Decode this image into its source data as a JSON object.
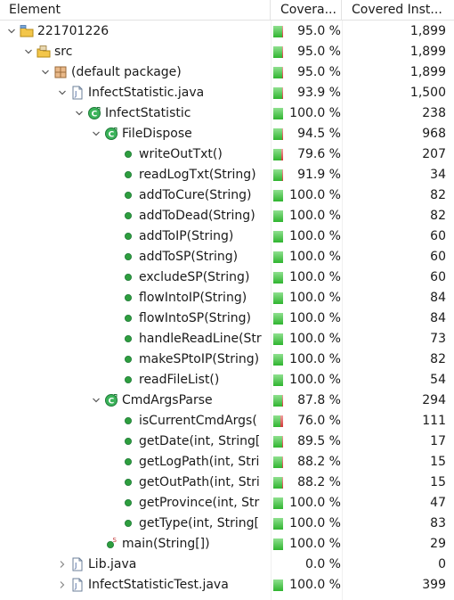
{
  "columns": {
    "element": "Element",
    "coverage": "Covera...",
    "covered": "Covered Inst..."
  },
  "rows": [
    {
      "label": "221701226",
      "coverage": "95.0 %",
      "covered": "1,899",
      "depth": 0,
      "twisty": "down",
      "icon": "project-icon",
      "bar": 95.0
    },
    {
      "label": "src",
      "coverage": "95.0 %",
      "covered": "1,899",
      "depth": 1,
      "twisty": "down",
      "icon": "source-folder-icon",
      "bar": 95.0
    },
    {
      "label": "(default package)",
      "coverage": "95.0 %",
      "covered": "1,899",
      "depth": 2,
      "twisty": "down",
      "icon": "package-icon",
      "bar": 95.0
    },
    {
      "label": "InfectStatistic.java",
      "coverage": "93.9 %",
      "covered": "1,500",
      "depth": 3,
      "twisty": "down",
      "icon": "java-file-icon",
      "bar": 93.9
    },
    {
      "label": "InfectStatistic",
      "coverage": "100.0 %",
      "covered": "238",
      "depth": 4,
      "twisty": "down",
      "icon": "class-icon",
      "bar": 100.0
    },
    {
      "label": "FileDispose",
      "coverage": "94.5 %",
      "covered": "968",
      "depth": 5,
      "twisty": "down",
      "icon": "class-icon",
      "bar": 94.5
    },
    {
      "label": "writeOutTxt()",
      "coverage": "79.6 %",
      "covered": "207",
      "depth": 6,
      "twisty": "",
      "icon": "method-icon",
      "bar": 79.6
    },
    {
      "label": "readLogTxt(String)",
      "coverage": "91.9 %",
      "covered": "34",
      "depth": 6,
      "twisty": "",
      "icon": "method-icon",
      "bar": 91.9
    },
    {
      "label": "addToCure(String)",
      "coverage": "100.0 %",
      "covered": "82",
      "depth": 6,
      "twisty": "",
      "icon": "method-icon",
      "bar": 100.0
    },
    {
      "label": "addToDead(String)",
      "coverage": "100.0 %",
      "covered": "82",
      "depth": 6,
      "twisty": "",
      "icon": "method-icon",
      "bar": 100.0
    },
    {
      "label": "addToIP(String)",
      "coverage": "100.0 %",
      "covered": "60",
      "depth": 6,
      "twisty": "",
      "icon": "method-icon",
      "bar": 100.0
    },
    {
      "label": "addToSP(String)",
      "coverage": "100.0 %",
      "covered": "60",
      "depth": 6,
      "twisty": "",
      "icon": "method-icon",
      "bar": 100.0
    },
    {
      "label": "excludeSP(String)",
      "coverage": "100.0 %",
      "covered": "60",
      "depth": 6,
      "twisty": "",
      "icon": "method-icon",
      "bar": 100.0
    },
    {
      "label": "flowIntoIP(String)",
      "coverage": "100.0 %",
      "covered": "84",
      "depth": 6,
      "twisty": "",
      "icon": "method-icon",
      "bar": 100.0
    },
    {
      "label": "flowIntoSP(String)",
      "coverage": "100.0 %",
      "covered": "84",
      "depth": 6,
      "twisty": "",
      "icon": "method-icon",
      "bar": 100.0
    },
    {
      "label": "handleReadLine(Str",
      "coverage": "100.0 %",
      "covered": "73",
      "depth": 6,
      "twisty": "",
      "icon": "method-icon",
      "bar": 100.0
    },
    {
      "label": "makeSPtoIP(String)",
      "coverage": "100.0 %",
      "covered": "82",
      "depth": 6,
      "twisty": "",
      "icon": "method-icon",
      "bar": 100.0
    },
    {
      "label": "readFileList()",
      "coverage": "100.0 %",
      "covered": "54",
      "depth": 6,
      "twisty": "",
      "icon": "method-icon",
      "bar": 100.0
    },
    {
      "label": "CmdArgsParse",
      "coverage": "87.8 %",
      "covered": "294",
      "depth": 5,
      "twisty": "down",
      "icon": "class-icon",
      "bar": 87.8
    },
    {
      "label": "isCurrentCmdArgs(",
      "coverage": "76.0 %",
      "covered": "111",
      "depth": 6,
      "twisty": "",
      "icon": "method-icon",
      "bar": 76.0
    },
    {
      "label": "getDate(int, String[",
      "coverage": "89.5 %",
      "covered": "17",
      "depth": 6,
      "twisty": "",
      "icon": "method-icon",
      "bar": 89.5
    },
    {
      "label": "getLogPath(int, Stri",
      "coverage": "88.2 %",
      "covered": "15",
      "depth": 6,
      "twisty": "",
      "icon": "method-icon",
      "bar": 88.2
    },
    {
      "label": "getOutPath(int, Stri",
      "coverage": "88.2 %",
      "covered": "15",
      "depth": 6,
      "twisty": "",
      "icon": "method-icon",
      "bar": 88.2
    },
    {
      "label": "getProvince(int, Str",
      "coverage": "100.0 %",
      "covered": "47",
      "depth": 6,
      "twisty": "",
      "icon": "method-icon",
      "bar": 100.0
    },
    {
      "label": "getType(int, String[",
      "coverage": "100.0 %",
      "covered": "83",
      "depth": 6,
      "twisty": "",
      "icon": "method-icon",
      "bar": 100.0
    },
    {
      "label": "main(String[])",
      "coverage": "100.0 %",
      "covered": "29",
      "depth": 5,
      "twisty": "",
      "icon": "static-method-icon",
      "bar": 100.0
    },
    {
      "label": "Lib.java",
      "coverage": "0.0 %",
      "covered": "0",
      "depth": 3,
      "twisty": "right",
      "icon": "java-file-icon",
      "bar": 0.0
    },
    {
      "label": "InfectStatisticTest.java",
      "coverage": "100.0 %",
      "covered": "399",
      "depth": 3,
      "twisty": "right",
      "icon": "java-file-icon",
      "bar": 100.0
    }
  ],
  "colors": {
    "covered": "#2fb42f",
    "missed": "#d03838",
    "method": "#2e9e3e",
    "class": "#2e9e3e"
  }
}
